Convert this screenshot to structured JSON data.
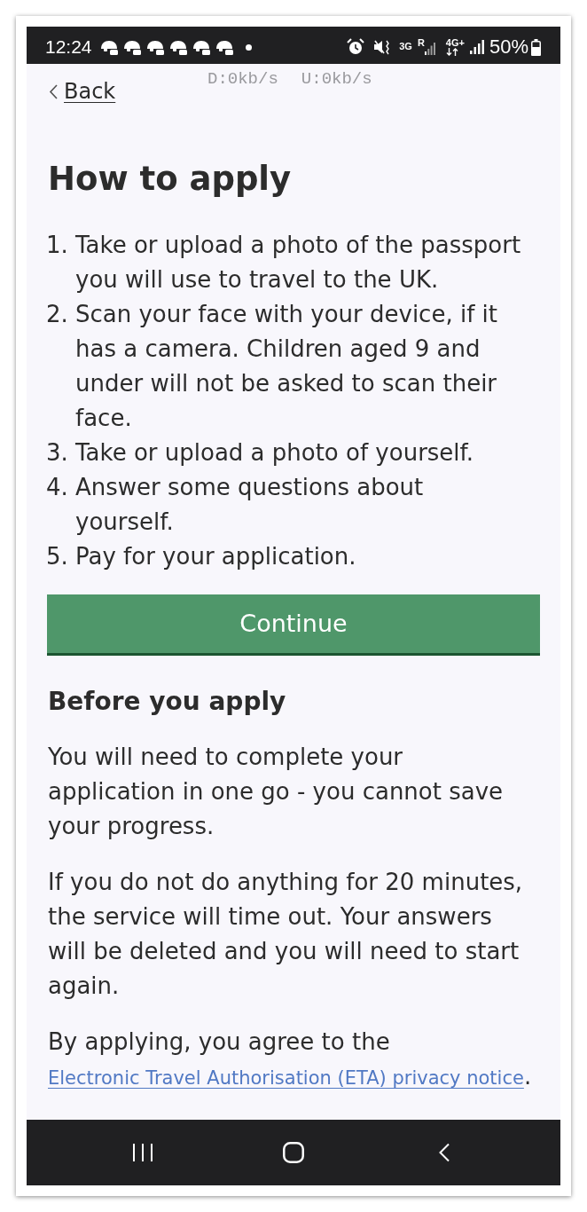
{
  "status_bar": {
    "time": "12:24",
    "network": [
      {
        "kind": "plain",
        "label": "3G"
      },
      {
        "kind": "signal",
        "label": "R"
      },
      {
        "kind": "data",
        "label": "4G+"
      }
    ],
    "battery": "50%"
  },
  "speed_overlay": [
    "D:0kb/s",
    "U:0kb/s"
  ],
  "back_link": {
    "label": "Back"
  },
  "heading": "How to apply",
  "steps": [
    {
      "number": "1.",
      "text": "Take or upload a photo of the passport you will use to travel to the UK."
    },
    {
      "number": "2.",
      "text": "Scan your face with your device, if it has a camera. Children aged 9 and under will not be asked to scan their face."
    },
    {
      "number": "3.",
      "text": "Take or upload a photo of yourself."
    },
    {
      "number": "4.",
      "text": "Answer some questions about yourself."
    },
    {
      "number": "5.",
      "text": "Pay for your application."
    }
  ],
  "continue_button": {
    "label": "Continue"
  },
  "before_you_apply": {
    "heading": "Before you apply",
    "paragraphs": [
      "You will need to complete your application in one go - you cannot save your progress.",
      "If you do not do anything for 20 minutes, the service will time out. Your answers will be deleted and you will need to start again."
    ],
    "privacy": {
      "text": "By applying, you agree to the ",
      "link": "Electronic Travel Authorisation (ETA) privacy notice",
      "after": "."
    }
  }
}
